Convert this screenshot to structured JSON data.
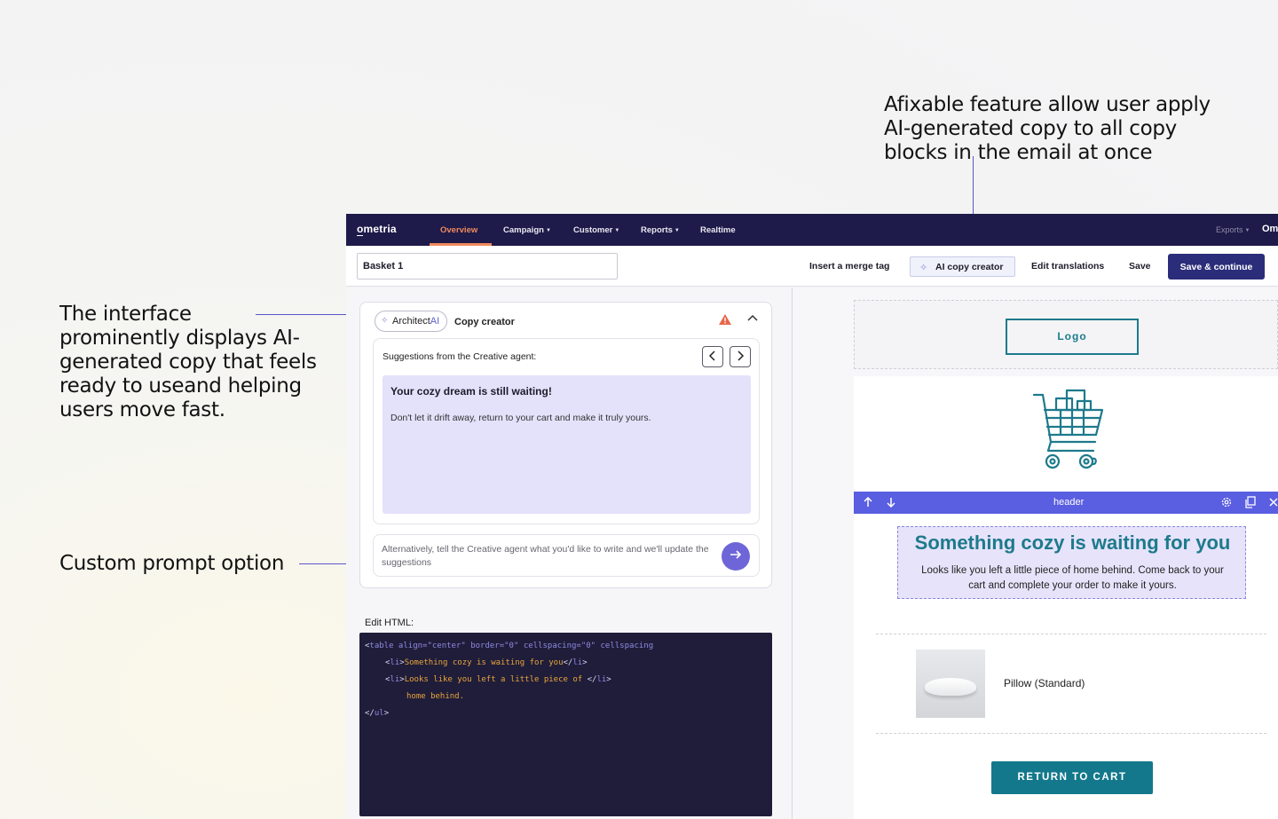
{
  "annotations": {
    "top": "Afixable feature allow user apply AI-generated copy to all copy blocks in the email at once",
    "left": "The interface prominently displays AI-generated copy that feels ready to useand helping users move fast.",
    "prompt": "Custom prompt option"
  },
  "nav": {
    "logo": "ometria",
    "items": [
      "Overview",
      "Campaign",
      "Customer",
      "Reports",
      "Realtime"
    ],
    "exports": "Exports",
    "user": "Om"
  },
  "toolbar": {
    "name_value": "Basket 1",
    "merge_tag": "Insert a merge tag",
    "ai_copy": "AI copy creator",
    "edit_translations": "Edit translations",
    "save": "Save",
    "save_continue": "Save & continue"
  },
  "ai_panel": {
    "pill_text": "Architect",
    "pill_ai": "AI",
    "title": "Copy creator",
    "suggestions_label": "Suggestions from the Creative agent:",
    "suggestion_heading": "Your cozy dream is still waiting!",
    "suggestion_body": "Don't let it drift away, return to your cart and make it truly yours.",
    "prompt_placeholder": "Alternatively, tell the Creative agent what you'd like to write and we'll update the suggestions"
  },
  "html_editor": {
    "label": "Edit HTML:",
    "lines": [
      {
        "tag_open": "<",
        "tag": "table",
        "rest": " align=\"center\" border=\"0\" cellspacing=\"0\" cellspacing",
        "text": ""
      },
      {
        "indent": 1,
        "tag": "li",
        "text": "Something cozy is waiting for you",
        "close": "li"
      },
      {
        "indent": 1,
        "tag": "li",
        "text": "Looks like you left a little piece of ",
        "close": "li"
      },
      {
        "indent": 2,
        "text": "home behind."
      },
      {
        "close_tag": "ul"
      }
    ]
  },
  "email": {
    "logo": "Logo",
    "header_label": "header",
    "headline": "Something cozy is waiting for you",
    "body": "Looks like you left a little piece of home behind. Come back to your cart and complete your order to make it yours.",
    "product_name": "Pillow (Standard)",
    "cta": "RETURN TO CART"
  },
  "colors": {
    "nav_bg": "#1e1a4a",
    "accent_orange": "#f08a5d",
    "primary_button": "#2b2d7a",
    "suggestion_bg": "#e4e1fb",
    "teal": "#1d7a8c",
    "header_bar": "#5a5ee0"
  }
}
